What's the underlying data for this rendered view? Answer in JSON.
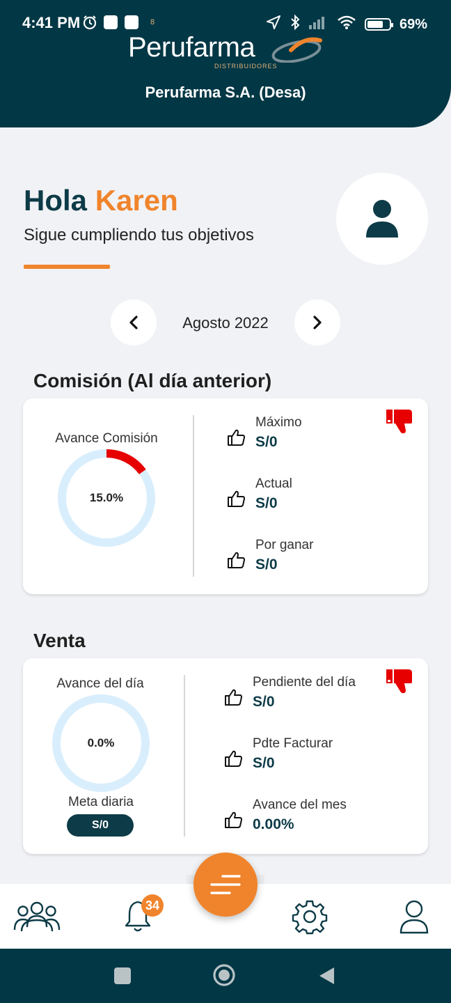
{
  "status_bar": {
    "time": "4:41 PM",
    "small_text": "8",
    "battery": "69%",
    "icons_left": [
      "alarm-icon",
      "outlook-icon",
      "vscode-icon"
    ],
    "icons_right": [
      "location-icon",
      "bluetooth-icon",
      "signal-icon",
      "wifi-icon",
      "battery-icon"
    ]
  },
  "header": {
    "brand": "Perufarma",
    "brand_sub": "DISTRIBUIDORES",
    "company": "Perufarma S.A. (Desa)"
  },
  "greeting": {
    "hello": "Hola",
    "name": "Karen",
    "subtitle": "Sigue cumpliendo tus objetivos"
  },
  "period": {
    "label": "Agosto 2022",
    "prev_icon": "chevron-left-icon",
    "next_icon": "chevron-right-icon"
  },
  "comision": {
    "title": "Comisión (Al día anterior)",
    "ring_label": "Avance Comisión",
    "ring_value": "15.0%",
    "ring_fraction": 0.15,
    "ring_color": "#e60000",
    "status_icon": "thumbs-down-icon",
    "metrics": [
      {
        "label": "Máximo",
        "value": "S/0"
      },
      {
        "label": "Actual",
        "value": "S/0"
      },
      {
        "label": "Por ganar",
        "value": "S/0"
      }
    ]
  },
  "venta": {
    "title": "Venta",
    "ring_label": "Avance del día",
    "ring_value": "0.0%",
    "ring_fraction": 0,
    "meta_label": "Meta diaria",
    "meta_value": "S/0",
    "status_icon": "thumbs-down-icon",
    "metrics": [
      {
        "label": "Pendiente del día",
        "value": "S/0"
      },
      {
        "label": "Pdte Facturar",
        "value": "S/0"
      },
      {
        "label": "Avance del mes",
        "value": "0.00%"
      }
    ]
  },
  "bottom_nav": {
    "items": [
      "team-icon",
      "bell-icon",
      "menu-icon",
      "gear-icon",
      "user-icon"
    ],
    "badge_count": "34"
  },
  "colors": {
    "primary": "#023745",
    "accent": "#f0842c",
    "ring_track": "#d9eefc",
    "alert": "#e60000"
  }
}
